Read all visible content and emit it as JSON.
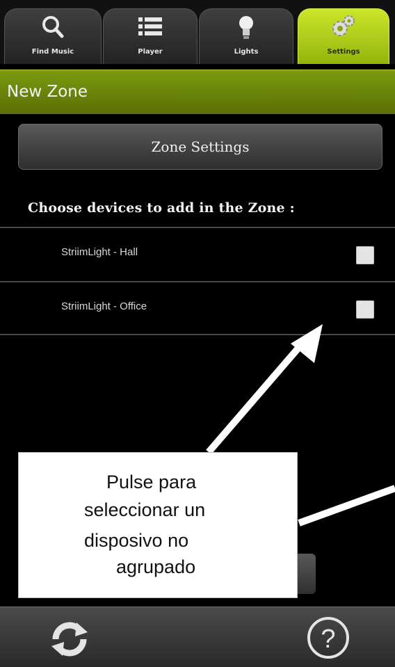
{
  "tabs": [
    {
      "label": "Find Music",
      "icon": "search-icon",
      "active": false
    },
    {
      "label": "Player",
      "icon": "list-icon",
      "active": false
    },
    {
      "label": "Lights",
      "icon": "lightbulb-icon",
      "active": false
    },
    {
      "label": "Settings",
      "icon": "gears-icon",
      "active": true
    }
  ],
  "header": {
    "title": "New Zone"
  },
  "zone_settings_label": "Zone Settings",
  "choose_heading": "Choose devices to add in the Zone :",
  "devices": [
    {
      "label": "StriimLight - Hall",
      "checked": false
    },
    {
      "label": "StriimLight - Office",
      "checked": false
    }
  ],
  "bottom_bar": {
    "left_icon": "refresh-icon",
    "right_icon": "help-icon"
  },
  "annotation": {
    "lines": [
      "Pulse para",
      "seleccionar un",
      "disposivo no",
      "agrupado"
    ]
  },
  "colors": {
    "accent": "#a8c61a",
    "title_bar": "#6d8a0c",
    "background": "#000000"
  }
}
